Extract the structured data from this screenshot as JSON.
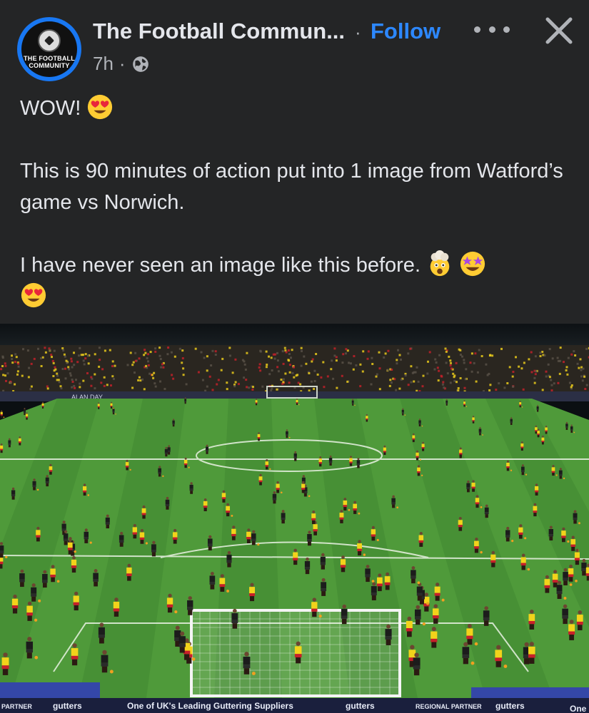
{
  "header": {
    "avatar_text_line1": "The Football",
    "avatar_text_line2": "Community",
    "page_name": "The Football Commun...",
    "separator": "·",
    "follow_label": "Follow",
    "time": "7h",
    "meta_separator": "·",
    "privacy_icon": "globe-icon",
    "more_icon": "more-options-icon",
    "close_icon": "close-icon"
  },
  "post": {
    "line1": "WOW!",
    "line1_emoji": "heart-eyes-emoji",
    "line2": "This is 90 minutes of action put into 1 image from Watford’s game vs Norwich.",
    "line3": "I have never seen an image like this before.",
    "line3_emojis": [
      "exploding-head-emoji",
      "star-struck-emoji",
      "heart-eyes-emoji"
    ]
  },
  "photo": {
    "description_icon": "composite-match-photo",
    "ad_boards": {
      "top_left": "ALAN DAY",
      "bottom_left": "PARTNER",
      "bottom_brand1": "gutters",
      "bottom_slogan": "One of UK's Leading Guttering Suppliers",
      "bottom_brand2": "gutters",
      "bottom_partner": "REGIONAL PARTNER",
      "bottom_brand3": "gutters",
      "bottom_right": "One"
    },
    "colors": {
      "pitch_light": "#4f9a3a",
      "pitch_dark": "#3f8530",
      "watford_yellow": "#f2d31b",
      "watford_red": "#c8202a",
      "dark_kit": "#1c1c1c"
    }
  },
  "theme": {
    "background": "#242526",
    "text": "#e4e6eb",
    "secondary_text": "#b0b3b8",
    "link": "#2d88ff",
    "avatar_ring": "#1877f2"
  }
}
